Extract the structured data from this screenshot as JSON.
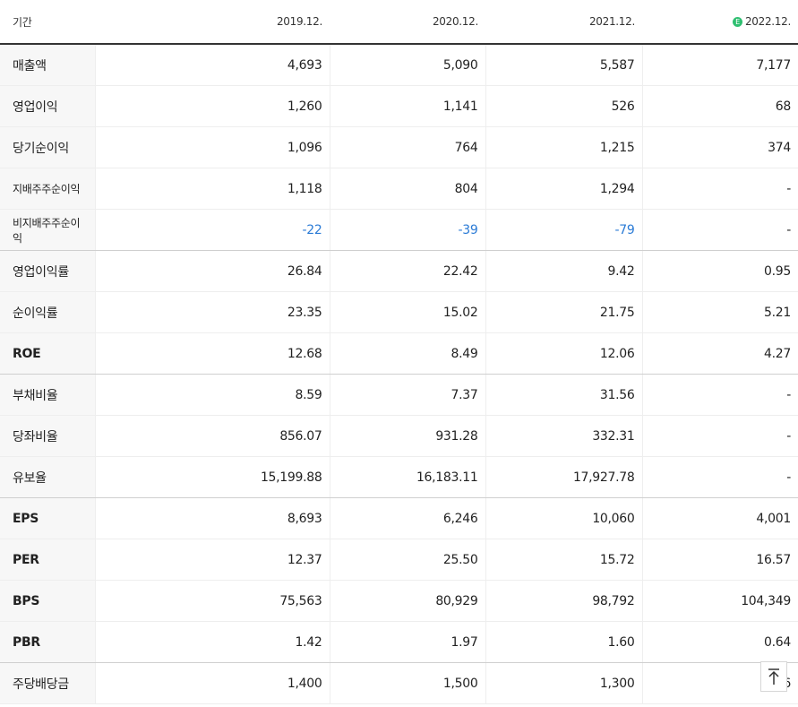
{
  "header": {
    "label": "기간",
    "periods": [
      "2019.12.",
      "2020.12.",
      "2021.12.",
      "2022.12."
    ],
    "estimate_badge": "E"
  },
  "rows": [
    {
      "label": "매출액",
      "values": [
        "4,693",
        "5,090",
        "5,587",
        "7,177"
      ]
    },
    {
      "label": "영업이익",
      "values": [
        "1,260",
        "1,141",
        "526",
        "68"
      ]
    },
    {
      "label": "당기순이익",
      "values": [
        "1,096",
        "764",
        "1,215",
        "374"
      ]
    },
    {
      "label": "지배주주순이익",
      "values": [
        "1,118",
        "804",
        "1,294",
        "-"
      ]
    },
    {
      "label": "비지배주주순이익",
      "values": [
        "-22",
        "-39",
        "-79",
        "-"
      ]
    },
    {
      "label": "영업이익률",
      "values": [
        "26.84",
        "22.42",
        "9.42",
        "0.95"
      ]
    },
    {
      "label": "순이익률",
      "values": [
        "23.35",
        "15.02",
        "21.75",
        "5.21"
      ]
    },
    {
      "label": "ROE",
      "values": [
        "12.68",
        "8.49",
        "12.06",
        "4.27"
      ]
    },
    {
      "label": "부채비율",
      "values": [
        "8.59",
        "7.37",
        "31.56",
        "-"
      ]
    },
    {
      "label": "당좌비율",
      "values": [
        "856.07",
        "931.28",
        "332.31",
        "-"
      ]
    },
    {
      "label": "유보율",
      "values": [
        "15,199.88",
        "16,183.11",
        "17,927.78",
        "-"
      ]
    },
    {
      "label": "EPS",
      "values": [
        "8,693",
        "6,246",
        "10,060",
        "4,001"
      ]
    },
    {
      "label": "PER",
      "values": [
        "12.37",
        "25.50",
        "15.72",
        "16.57"
      ]
    },
    {
      "label": "BPS",
      "values": [
        "75,563",
        "80,929",
        "98,792",
        "104,349"
      ]
    },
    {
      "label": "PBR",
      "values": [
        "1.42",
        "1.97",
        "1.60",
        "0.64"
      ]
    },
    {
      "label": "주당배당금",
      "values": [
        "1,400",
        "1,500",
        "1,300",
        "6"
      ]
    }
  ],
  "colors": {
    "negative": "#2b7bd6",
    "estimate_badge": "#2fbf71",
    "header_rule": "#333333"
  },
  "icons": {
    "scroll_top": "arrow-up-icon"
  }
}
